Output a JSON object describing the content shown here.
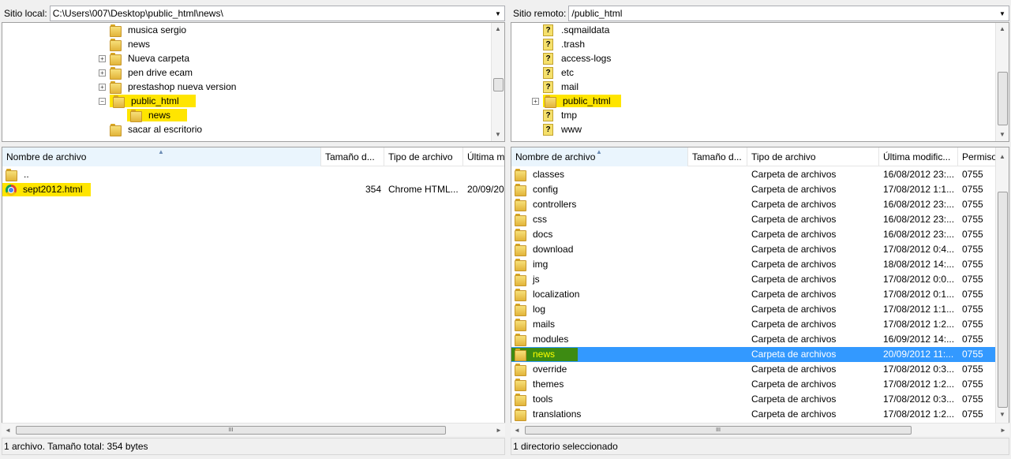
{
  "local": {
    "path_label": "Sitio local:",
    "path_value": "C:\\Users\\007\\Desktop\\public_html\\news\\",
    "tree": [
      {
        "label": "musica sergio",
        "expander": "",
        "highlight": false
      },
      {
        "label": "news",
        "expander": "",
        "highlight": false
      },
      {
        "label": "Nueva carpeta",
        "expander": "+",
        "highlight": false
      },
      {
        "label": "pen drive ecam",
        "expander": "+",
        "highlight": false
      },
      {
        "label": "prestashop nueva version",
        "expander": "+",
        "highlight": false
      },
      {
        "label": "public_html",
        "expander": "−",
        "highlight": true
      },
      {
        "label": "news",
        "expander": "",
        "highlight": true,
        "child": true
      },
      {
        "label": "sacar al escritorio",
        "expander": "",
        "highlight": false
      }
    ],
    "columns": [
      "Nombre de archivo",
      "Tamaño d...",
      "Tipo de archivo",
      "Última m"
    ],
    "files": [
      {
        "name": "..",
        "size": "",
        "type": "",
        "modified": "",
        "icon": "folder-icon",
        "highlight": false
      },
      {
        "name": "sept2012.html",
        "size": "354",
        "type": "Chrome HTML...",
        "modified": "20/09/20",
        "icon": "chrome-icon",
        "highlight": true
      }
    ],
    "status": "1 archivo. Tamaño total: 354 bytes"
  },
  "remote": {
    "path_label": "Sitio remoto:",
    "path_value": "/public_html",
    "tree": [
      {
        "label": ".sqmaildata",
        "expander": "",
        "highlight": false,
        "icon": "unknown-icon"
      },
      {
        "label": ".trash",
        "expander": "",
        "highlight": false,
        "icon": "unknown-icon"
      },
      {
        "label": "access-logs",
        "expander": "",
        "highlight": false,
        "icon": "unknown-icon"
      },
      {
        "label": "etc",
        "expander": "",
        "highlight": false,
        "icon": "unknown-icon"
      },
      {
        "label": "mail",
        "expander": "",
        "highlight": false,
        "icon": "unknown-icon"
      },
      {
        "label": "public_html",
        "expander": "+",
        "highlight": true,
        "icon": "folder-icon"
      },
      {
        "label": "tmp",
        "expander": "",
        "highlight": false,
        "icon": "unknown-icon"
      },
      {
        "label": "www",
        "expander": "",
        "highlight": false,
        "icon": "unknown-icon"
      }
    ],
    "columns": [
      "Nombre de archivo",
      "Tamaño d...",
      "Tipo de archivo",
      "Última modific...",
      "Permiso"
    ],
    "files": [
      {
        "name": "classes",
        "type": "Carpeta de archivos",
        "modified": "16/08/2012 23:...",
        "perm": "0755"
      },
      {
        "name": "config",
        "type": "Carpeta de archivos",
        "modified": "17/08/2012 1:1...",
        "perm": "0755"
      },
      {
        "name": "controllers",
        "type": "Carpeta de archivos",
        "modified": "16/08/2012 23:...",
        "perm": "0755"
      },
      {
        "name": "css",
        "type": "Carpeta de archivos",
        "modified": "16/08/2012 23:...",
        "perm": "0755"
      },
      {
        "name": "docs",
        "type": "Carpeta de archivos",
        "modified": "16/08/2012 23:...",
        "perm": "0755"
      },
      {
        "name": "download",
        "type": "Carpeta de archivos",
        "modified": "17/08/2012 0:4...",
        "perm": "0755"
      },
      {
        "name": "img",
        "type": "Carpeta de archivos",
        "modified": "18/08/2012 14:...",
        "perm": "0755"
      },
      {
        "name": "js",
        "type": "Carpeta de archivos",
        "modified": "17/08/2012 0:0...",
        "perm": "0755"
      },
      {
        "name": "localization",
        "type": "Carpeta de archivos",
        "modified": "17/08/2012 0:1...",
        "perm": "0755"
      },
      {
        "name": "log",
        "type": "Carpeta de archivos",
        "modified": "17/08/2012 1:1...",
        "perm": "0755"
      },
      {
        "name": "mails",
        "type": "Carpeta de archivos",
        "modified": "17/08/2012 1:2...",
        "perm": "0755"
      },
      {
        "name": "modules",
        "type": "Carpeta de archivos",
        "modified": "16/09/2012 14:...",
        "perm": "0755"
      },
      {
        "name": "news",
        "type": "Carpeta de archivos",
        "modified": "20/09/2012 11:...",
        "perm": "0755",
        "selected": true
      },
      {
        "name": "override",
        "type": "Carpeta de archivos",
        "modified": "17/08/2012 0:3...",
        "perm": "0755"
      },
      {
        "name": "themes",
        "type": "Carpeta de archivos",
        "modified": "17/08/2012 1:2...",
        "perm": "0755"
      },
      {
        "name": "tools",
        "type": "Carpeta de archivos",
        "modified": "17/08/2012 0:3...",
        "perm": "0755"
      },
      {
        "name": "translations",
        "type": "Carpeta de archivos",
        "modified": "17/08/2012 1:2...",
        "perm": "0755"
      }
    ],
    "status": "1 directorio seleccionado"
  },
  "colors": {
    "highlight": "#ffe500",
    "selection": "#3399ff",
    "selected_name_bg": "#3d8b12"
  }
}
